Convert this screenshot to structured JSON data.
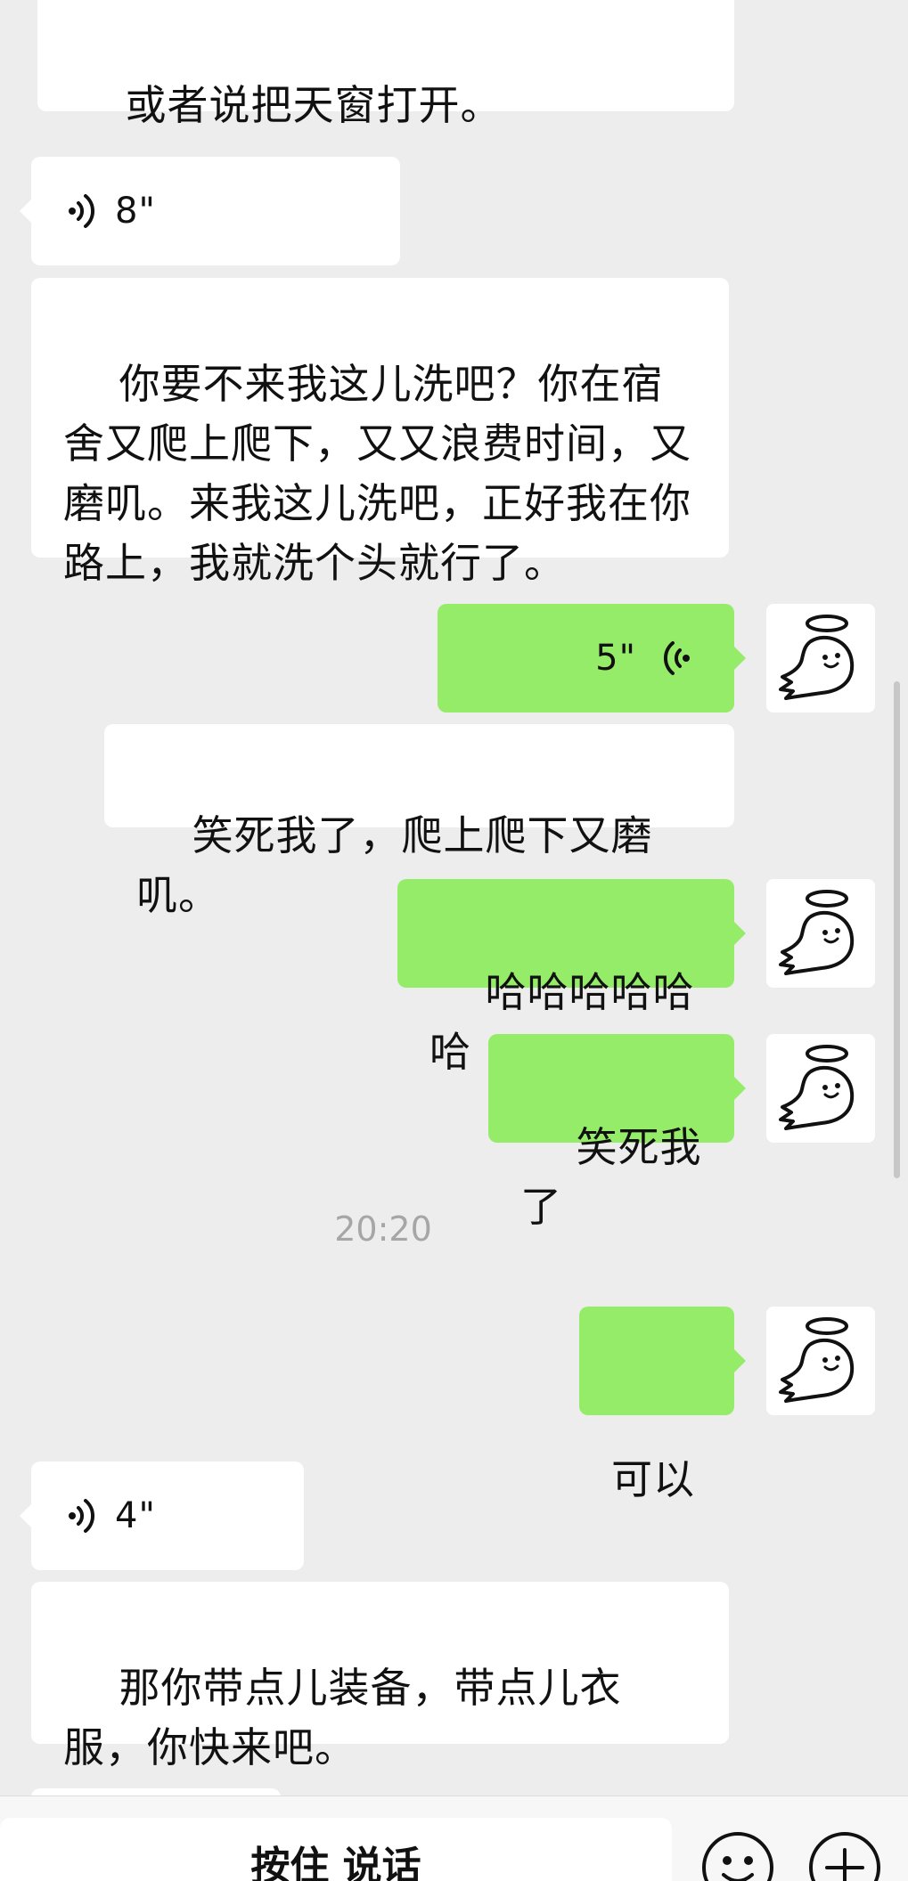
{
  "messages": [
    {
      "side": "in",
      "type": "text",
      "text": "或者说把天窗打开。"
    },
    {
      "side": "in",
      "type": "voice",
      "duration": "8\""
    },
    {
      "side": "in",
      "type": "text",
      "text": "你要不来我这儿洗吧？你在宿舍又爬上爬下，又又浪费时间，又磨叽。来我这儿洗吧，正好我在你路上，我就洗个头就行了。"
    },
    {
      "side": "out",
      "type": "voice",
      "duration": "5\""
    },
    {
      "side": "out",
      "type": "text",
      "text": "笑死我了，爬上爬下又磨叽。"
    },
    {
      "side": "out",
      "type": "text",
      "text": "哈哈哈哈哈哈"
    },
    {
      "side": "out",
      "type": "text",
      "text": "笑死我了"
    },
    {
      "type": "timestamp",
      "text": "20:20"
    },
    {
      "side": "out",
      "type": "text",
      "text": "可以"
    },
    {
      "side": "in",
      "type": "voice",
      "duration": "4\""
    },
    {
      "side": "in",
      "type": "text",
      "text": "那你带点儿装备，带点儿衣服，你快来吧。"
    }
  ],
  "input_bar": {
    "hold_to_talk_label": "按住 说话",
    "emoji_icon": "emoji-icon",
    "plus_icon": "plus-icon"
  },
  "colors": {
    "background": "#ededed",
    "incoming_bubble": "#ffffff",
    "outgoing_bubble": "#95ec69",
    "timestamp_text": "#a6a6a6"
  }
}
